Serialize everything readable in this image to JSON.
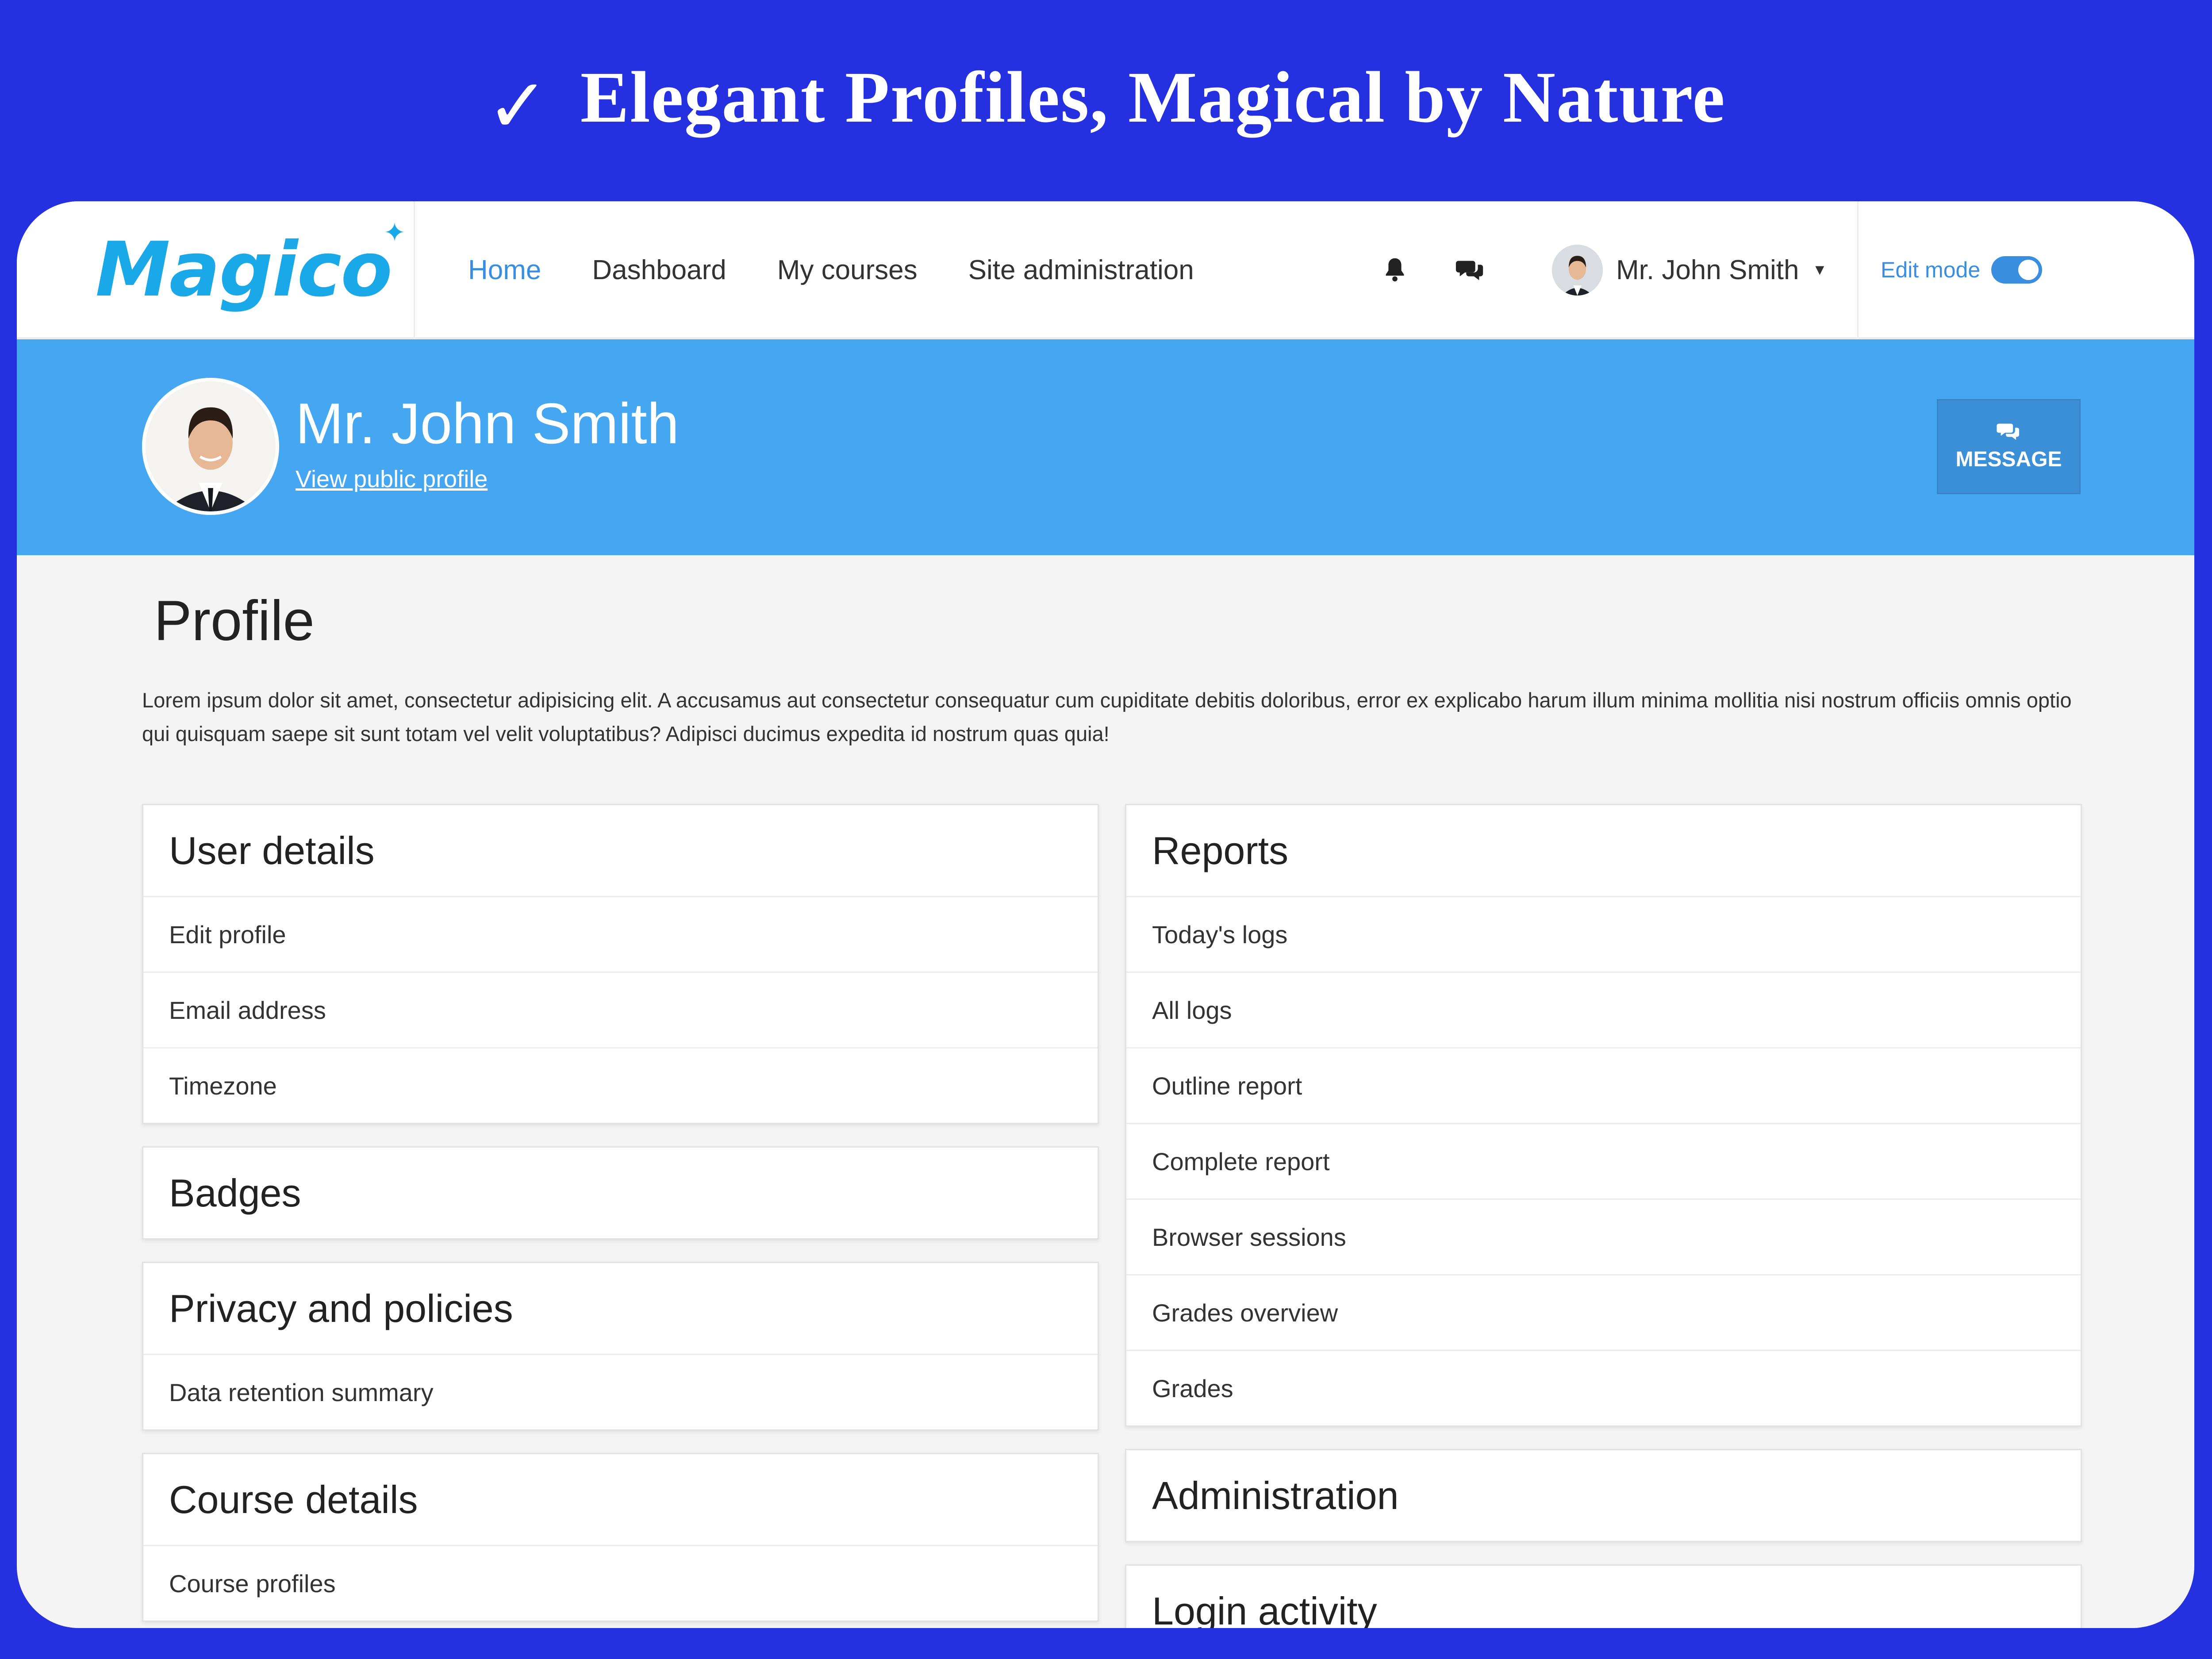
{
  "banner": {
    "check": "✓",
    "headline": "Elegant Profiles, Magical by Nature"
  },
  "navbar": {
    "logo": "Magico",
    "links": [
      "Home",
      "Dashboard",
      "My courses",
      "Site administration"
    ],
    "active_link": "Home",
    "notification_icon": "bell-icon",
    "messages_icon": "chat-icon",
    "user_name": "Mr. John Smith",
    "edit_mode_label": "Edit mode",
    "edit_mode_on": true
  },
  "profile_header": {
    "name": "Mr. John Smith",
    "public_link": "View public profile",
    "message_button": "MESSAGE"
  },
  "main": {
    "title": "Profile",
    "intro": "Lorem ipsum dolor sit amet, consectetur adipisicing elit. A accusamus aut consectetur consequatur cum cupiditate debitis doloribus, error ex explicabo harum illum minima mollitia nisi nostrum officiis omnis optio qui quisquam saepe sit sunt totam vel velit voluptatibus? Adipisci ducimus expedita id nostrum quas quia!"
  },
  "left_cards": [
    {
      "title": "User details",
      "items": [
        "Edit profile",
        "Email address",
        "Timezone"
      ]
    },
    {
      "title": "Badges",
      "items": []
    },
    {
      "title": "Privacy and policies",
      "items": [
        "Data retention summary"
      ]
    },
    {
      "title": "Course details",
      "items": [
        "Course profiles"
      ]
    }
  ],
  "right_cards": [
    {
      "title": "Reports",
      "items": [
        "Today's logs",
        "All logs",
        "Outline report",
        "Complete report",
        "Browser sessions",
        "Grades overview",
        "Grades"
      ]
    },
    {
      "title": "Administration",
      "items": []
    },
    {
      "title": "Login activity",
      "items": []
    }
  ],
  "colors": {
    "background": "#2530e0",
    "accent": "#45a6f2",
    "link": "#3a8ee0",
    "logo": "#19a8e8"
  }
}
